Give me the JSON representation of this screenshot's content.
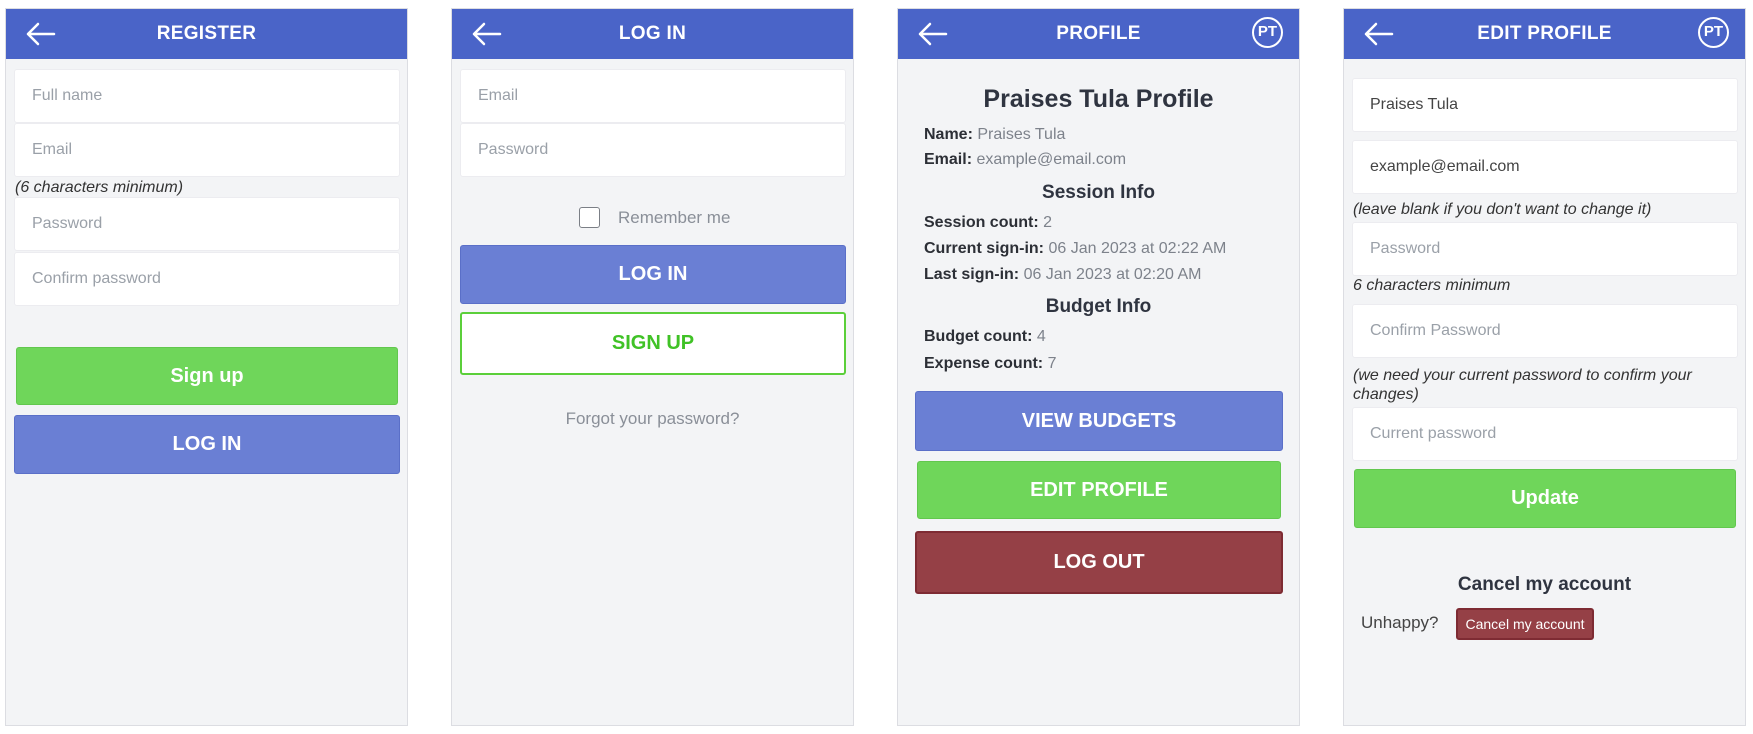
{
  "register": {
    "title": "REGISTER",
    "full_name_placeholder": "Full name",
    "email_placeholder": "Email",
    "password_hint": "(6 characters minimum)",
    "password_placeholder": "Password",
    "confirm_placeholder": "Confirm password",
    "signup_label": "Sign up",
    "login_label": "LOG IN"
  },
  "login": {
    "title": "LOG IN",
    "email_placeholder": "Email",
    "password_placeholder": "Password",
    "remember_label": "Remember me",
    "login_label": "LOG IN",
    "signup_label": "SIGN UP",
    "forgot_label": "Forgot your password?"
  },
  "profile": {
    "title": "PROFILE",
    "avatar": "PT",
    "heading": "Praises Tula Profile",
    "name_label": "Name:",
    "name_value": "Praises Tula",
    "email_label": "Email:",
    "email_value": "example@email.com",
    "session_heading": "Session Info",
    "session_count_label": "Session count:",
    "session_count_value": "2",
    "current_signin_label": "Current sign-in:",
    "current_signin_value": "06 Jan 2023 at 02:22 AM",
    "last_signin_label": "Last sign-in:",
    "last_signin_value": "06 Jan 2023 at 02:20 AM",
    "budget_heading": "Budget Info",
    "budget_count_label": "Budget count:",
    "budget_count_value": "4",
    "expense_count_label": "Expense count:",
    "expense_count_value": "7",
    "view_budgets_label": "VIEW BUDGETS",
    "edit_profile_label": "EDIT PROFILE",
    "logout_label": "LOG OUT"
  },
  "edit_profile": {
    "title": "EDIT PROFILE",
    "avatar": "PT",
    "name_value": "Praises Tula",
    "email_value": "example@email.com",
    "blank_hint": "(leave blank if you don't want to change it)",
    "password_placeholder": "Password",
    "min_hint": "6 characters minimum",
    "confirm_placeholder": "Confirm Password",
    "current_hint": "(we need your current password to confirm your changes)",
    "current_placeholder": "Current password",
    "update_label": "Update",
    "cancel_heading": "Cancel my account",
    "unhappy_label": "Unhappy?",
    "cancel_button_label": "Cancel my account"
  },
  "colors": {
    "header": "#4a64c8",
    "primary_button": "#6a7fd4",
    "success_button": "#6fd65a",
    "danger_button": "#954046",
    "panel_bg": "#f3f4f6"
  }
}
